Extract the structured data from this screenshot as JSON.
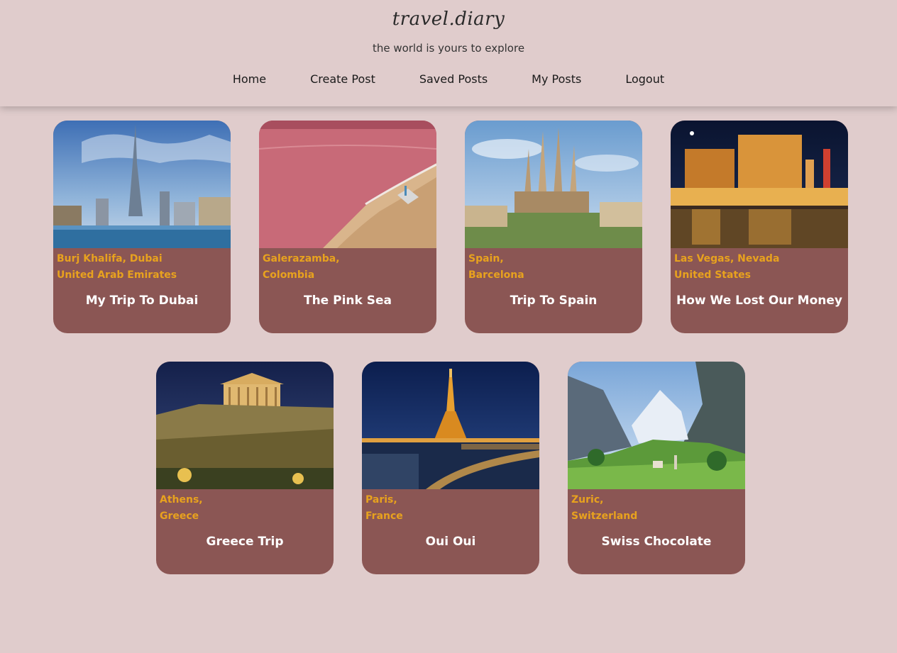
{
  "header": {
    "logo": "travel.diary",
    "tagline": "the world is yours to explore",
    "nav": [
      "Home",
      "Create Post",
      "Saved Posts",
      "My Posts",
      "Logout"
    ]
  },
  "colors": {
    "background": "#e0cccc",
    "card": "#8b5654",
    "location_text": "#e8a21e",
    "title_text": "#ffffff"
  },
  "posts": [
    {
      "location_line1": "Burj Khalifa, Dubai",
      "location_line2": "United Arab Emirates",
      "title": "My Trip To Dubai",
      "image": "dubai-skyline-photo"
    },
    {
      "location_line1": "Galerazamba,",
      "location_line2": "Colombia",
      "title": "The Pink Sea",
      "image": "pink-sea-photo"
    },
    {
      "location_line1": "Spain,",
      "location_line2": "Barcelona",
      "title": "Trip To Spain",
      "image": "sagrada-familia-photo"
    },
    {
      "location_line1": "Las Vegas, Nevada",
      "location_line2": "United States",
      "title": "How We Lost Our Money",
      "image": "las-vegas-night-photo"
    },
    {
      "location_line1": "Athens,",
      "location_line2": "Greece",
      "title": "Greece Trip",
      "image": "acropolis-night-photo"
    },
    {
      "location_line1": "Paris,",
      "location_line2": "France",
      "title": "Oui Oui",
      "image": "eiffel-tower-night-photo"
    },
    {
      "location_line1": "Zuric,",
      "location_line2": "Switzerland",
      "title": "Swiss Chocolate",
      "image": "swiss-valley-photo"
    }
  ]
}
